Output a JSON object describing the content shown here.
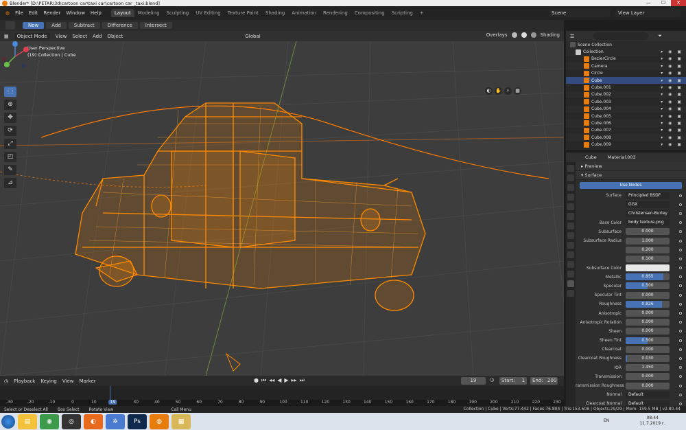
{
  "window": {
    "title": "Blender* [D:\\PETAR\\3d\\cartoon car\\taxi car\\cartoon car _taxi.blend]",
    "minimize": "—",
    "maximize": "☐",
    "close": "✕"
  },
  "menu": [
    "File",
    "Edit",
    "Render",
    "Window",
    "Help"
  ],
  "workspaces": [
    "Layout",
    "Modeling",
    "Sculpting",
    "UV Editing",
    "Texture Paint",
    "Shading",
    "Animation",
    "Rendering",
    "Compositing",
    "Scripting"
  ],
  "workspace_add": "+",
  "scene": "Scene",
  "view_layer": "View Layer",
  "tool_modes": [
    "New",
    "Add",
    "Subtract",
    "Difference",
    "Intersect"
  ],
  "viewport_header": {
    "mode": "Object Mode",
    "view": "View",
    "select": "Select",
    "add": "Add",
    "object": "Object",
    "orientation": "Global",
    "overlays": "Overlays",
    "shading": "Shading"
  },
  "viewport": {
    "perspective": "User Perspective",
    "collection_info": "(19) Collection | Cube"
  },
  "outliner": {
    "root": "Scene Collection",
    "rows": [
      {
        "name": "Collection",
        "color": "#cccccc"
      },
      {
        "name": "BezierCircle",
        "color": "#e87d0d"
      },
      {
        "name": "Camera",
        "color": "#e87d0d"
      },
      {
        "name": "Circle",
        "color": "#e87d0d"
      },
      {
        "name": "Cube",
        "color": "#e87d0d"
      },
      {
        "name": "Cube.001",
        "color": "#e87d0d"
      },
      {
        "name": "Cube.002",
        "color": "#e87d0d"
      },
      {
        "name": "Cube.003",
        "color": "#e87d0d"
      },
      {
        "name": "Cube.004",
        "color": "#e87d0d"
      },
      {
        "name": "Cube.005",
        "color": "#e87d0d"
      },
      {
        "name": "Cube.006",
        "color": "#e87d0d"
      },
      {
        "name": "Cube.007",
        "color": "#e87d0d"
      },
      {
        "name": "Cube.008",
        "color": "#e87d0d"
      },
      {
        "name": "Cube.009",
        "color": "#e87d0d"
      }
    ]
  },
  "properties": {
    "object": "Cube",
    "material": "Material.003",
    "preview": "Preview",
    "surface_panel": "Surface",
    "use_nodes": "Use Nodes",
    "rows": [
      {
        "label": "Surface",
        "value": "Principled BSDF",
        "kind": "dd"
      },
      {
        "label": "",
        "value": "GGX",
        "kind": "dd"
      },
      {
        "label": "",
        "value": "Christensen-Burley",
        "kind": "dd"
      },
      {
        "label": "Base Color",
        "value": "body texture.png",
        "kind": "dd"
      },
      {
        "label": "Subsurface",
        "value": "0.000",
        "kind": "num",
        "fill": 0
      },
      {
        "label": "Subsurface Radius",
        "value": "1.000",
        "kind": "num",
        "fill": 0
      },
      {
        "label": "",
        "value": "0.200",
        "kind": "num",
        "fill": 0
      },
      {
        "label": "",
        "value": "0.100",
        "kind": "num",
        "fill": 0
      },
      {
        "label": "Subsurface Color",
        "value": "",
        "kind": "white"
      },
      {
        "label": "Metallic",
        "value": "0.855",
        "kind": "num",
        "fill": 0.855
      },
      {
        "label": "Specular",
        "value": "0.500",
        "kind": "num",
        "fill": 0.5
      },
      {
        "label": "Specular Tint",
        "value": "0.000",
        "kind": "num",
        "fill": 0
      },
      {
        "label": "Roughness",
        "value": "0.826",
        "kind": "num",
        "fill": 0.826
      },
      {
        "label": "Anisotropic",
        "value": "0.000",
        "kind": "num",
        "fill": 0
      },
      {
        "label": "Anisotropic Rotation",
        "value": "0.000",
        "kind": "num",
        "fill": 0
      },
      {
        "label": "Sheen",
        "value": "0.000",
        "kind": "num",
        "fill": 0
      },
      {
        "label": "Sheen Tint",
        "value": "0.500",
        "kind": "num",
        "fill": 0.5
      },
      {
        "label": "Clearcoat",
        "value": "0.000",
        "kind": "num",
        "fill": 0
      },
      {
        "label": "Clearcoat Roughness",
        "value": "0.030",
        "kind": "num",
        "fill": 0.03
      },
      {
        "label": "IOR",
        "value": "1.450",
        "kind": "num",
        "fill": 0
      },
      {
        "label": "Transmission",
        "value": "0.000",
        "kind": "num",
        "fill": 0
      },
      {
        "label": "ransmission Roughness",
        "value": "0.000",
        "kind": "num",
        "fill": 0
      },
      {
        "label": "Normal",
        "value": "Default",
        "kind": "dd"
      },
      {
        "label": "Clearcoat Normal",
        "value": "Default",
        "kind": "dd"
      }
    ]
  },
  "timeline": {
    "playback": "Playback",
    "keying": "Keying",
    "view": "View",
    "marker": "Marker",
    "current_frame": "19",
    "start_label": "Start:",
    "start": "1",
    "end_label": "End:",
    "end": "200",
    "ruler": [
      "-30",
      "-20",
      "-10",
      "0",
      "10",
      "19",
      "30",
      "40",
      "50",
      "60",
      "70",
      "80",
      "90",
      "100",
      "110",
      "120",
      "130",
      "140",
      "150",
      "160",
      "170",
      "180",
      "190",
      "200",
      "210",
      "220",
      "230"
    ]
  },
  "status": {
    "select": "Select or Deselect All",
    "box": "Box Select",
    "rotate": "Rotate View",
    "call_menu": "Call Menu",
    "stats": "Collection | Cube | Verts:77.442 | Faces:76.804 | Tris:153.608 | Objects:29/29 | Mem: 159.5 MB | v2.80.44"
  },
  "taskbar": {
    "apps": [
      {
        "name": "explorer",
        "color": "#f3c13a",
        "glyph": "▤"
      },
      {
        "name": "chrome",
        "color": "#3c9a4a",
        "glyph": "◉"
      },
      {
        "name": "obs",
        "color": "#333333",
        "glyph": "◎"
      },
      {
        "name": "firefox",
        "color": "#e86a1c",
        "glyph": "◐"
      },
      {
        "name": "settings",
        "color": "#4a7bd0",
        "glyph": "✲"
      },
      {
        "name": "photoshop",
        "color": "#0f2a4d",
        "glyph": "Ps"
      },
      {
        "name": "blender",
        "color": "#e87d0d",
        "glyph": "◍"
      },
      {
        "name": "files",
        "color": "#d9b85a",
        "glyph": "▦"
      }
    ],
    "lang": "EN",
    "time": "08:44",
    "date": "11.7.2019 г."
  },
  "colors": {
    "accent": "#4772b3",
    "wire": "#ff8a00",
    "viewport_bg": "#3d3d3d"
  }
}
